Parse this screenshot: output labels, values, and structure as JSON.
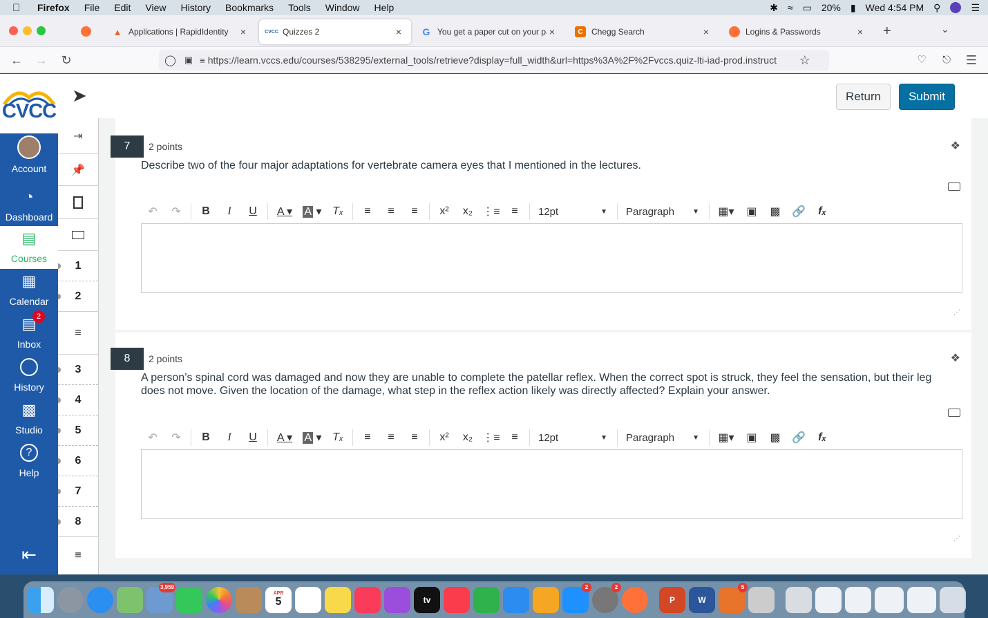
{
  "menubar": {
    "app": "Firefox",
    "items": [
      "File",
      "Edit",
      "View",
      "History",
      "Bookmarks",
      "Tools",
      "Window",
      "Help"
    ],
    "battery": "20%",
    "clock": "Wed 4:54 PM"
  },
  "tabs": [
    {
      "title": "Applications | RapidIdentity",
      "close": "×"
    },
    {
      "title": "Quizzes 2",
      "close": "×"
    },
    {
      "title": "You get a paper cut on your palm",
      "close": "×"
    },
    {
      "title": "Chegg Search",
      "close": "×"
    },
    {
      "title": "Logins & Passwords",
      "close": "×"
    }
  ],
  "tab_favicons": {
    "quizzes": "CVCC",
    "google": "G",
    "chegg": "C"
  },
  "new_tab": "+",
  "url": "https://learn.vccs.edu/courses/538295/external_tools/retrieve?display=full_width&url=https%3A%2F%2Fvccs.quiz-lti-iad-prod.instruct",
  "logo_text": "CVCC",
  "global_nav": [
    {
      "label": "Account"
    },
    {
      "label": "Dashboard"
    },
    {
      "label": "Courses"
    },
    {
      "label": "Calendar"
    },
    {
      "label": "Inbox",
      "badge": "2"
    },
    {
      "label": "History"
    },
    {
      "label": "Studio"
    },
    {
      "label": "Help"
    }
  ],
  "buttons": {
    "return": "Return",
    "submit": "Submit"
  },
  "question_nav": [
    "1",
    "2",
    "3",
    "4",
    "5",
    "6",
    "7",
    "8"
  ],
  "questions": [
    {
      "number": "7",
      "points": "2 points",
      "text": "Describe two of the four major adaptations for vertebrate camera eyes that I mentioned in the lectures."
    },
    {
      "number": "8",
      "points": "2 points",
      "text": "A person’s spinal cord was damaged and now they are unable to complete the patellar reflex. When the correct spot is struck, they feel the sensation, but their leg does not move. Given the location of the damage, what step in the reflex action likely was directly affected? Explain your answer."
    }
  ],
  "editor": {
    "font_size": "12pt",
    "block_format": "Paragraph"
  },
  "dock_badges": {
    "photos": "3,959",
    "calendar_day": "5",
    "calendar_month": "APR",
    "appstore": "2",
    "settings": "2",
    "office": "5"
  },
  "dock_labels": {
    "tv": "tv",
    "powerpoint": "P",
    "word": "W"
  }
}
